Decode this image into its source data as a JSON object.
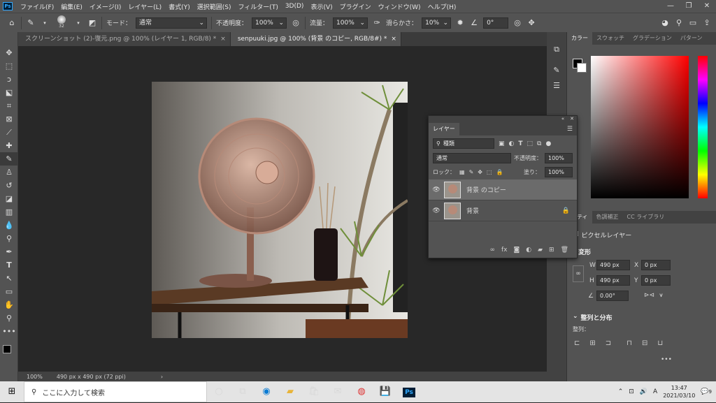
{
  "app": {
    "logo": "Ps"
  },
  "menu": [
    "ファイル(F)",
    "編集(E)",
    "イメージ(I)",
    "レイヤー(L)",
    "書式(Y)",
    "選択範囲(S)",
    "フィルター(T)",
    "3D(D)",
    "表示(V)",
    "プラグイン",
    "ウィンドウ(W)",
    "ヘルプ(H)"
  ],
  "options": {
    "brush_size": "32",
    "mode_label": "モード：",
    "mode_value": "通常",
    "opacity_label": "不透明度：",
    "opacity_value": "100%",
    "flow_label": "流量：",
    "flow_value": "100%",
    "smooth_label": "滑らかさ：",
    "smooth_value": "10%",
    "angle_value": "0°"
  },
  "tabs": [
    {
      "label": "スクリーンショット (2)-復元.png @ 100% (レイヤー 1, RGB/8) *",
      "close": "×"
    },
    {
      "label": "senpuuki.jpg @ 100% (背景 のコピー, RGB/8#) *",
      "close": "×"
    }
  ],
  "status": {
    "zoom": "100%",
    "info": "490 px x 490 px (72 ppi)",
    "arrow": "›"
  },
  "color_panel": {
    "tabs": [
      "カラー",
      "スウォッチ",
      "グラデーション",
      "パターン"
    ]
  },
  "layers_panel": {
    "title": "レイヤー",
    "filter_label": "種類",
    "blend_mode": "通常",
    "opacity_label": "不透明度：",
    "opacity_value": "100%",
    "lock_label": "ロック：",
    "fill_label": "塗り：",
    "fill_value": "100%",
    "layers": [
      {
        "name": "背景 のコピー",
        "selected": true
      },
      {
        "name": "背景",
        "selected": false
      }
    ]
  },
  "properties_panel": {
    "tabs": [
      "パティ",
      "色調補正",
      "CC ライブラリ"
    ],
    "type": "ピクセルレイヤー",
    "transform_title": "変形",
    "w_label": "W",
    "w_value": "490 px",
    "h_label": "H",
    "h_value": "490 px",
    "x_label": "X",
    "x_value": "0 px",
    "y_label": "Y",
    "y_value": "0 px",
    "angle_value": "0.00°",
    "align_title": "整列と分布",
    "align_label": "整列：",
    "more": "•••"
  },
  "taskbar": {
    "search_placeholder": "ここに入力して検索",
    "time": "13:47",
    "date": "2021/03/10",
    "ime": "A",
    "notif": "9"
  }
}
